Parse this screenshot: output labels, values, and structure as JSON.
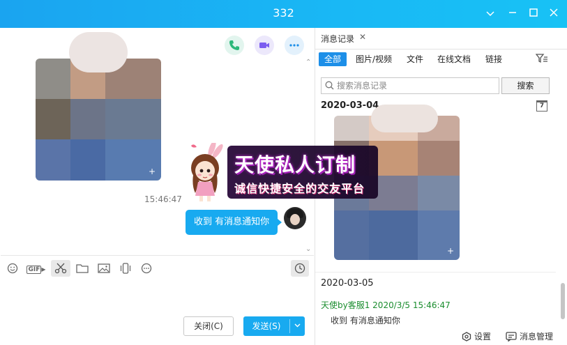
{
  "window": {
    "title": "332"
  },
  "chat": {
    "timestamp": "15:46:47",
    "bubble_text": "收到 有消息通知你"
  },
  "actions": {
    "close_label": "关闭(C)",
    "send_label": "发送(S)"
  },
  "history": {
    "tab_label": "消息记录",
    "filters": [
      "全部",
      "图片/视频",
      "文件",
      "在线文档",
      "链接"
    ],
    "search_placeholder": "搜索消息记录",
    "search_button": "搜索",
    "date1": "2020-03-04",
    "calendar_day": "7",
    "date2": "2020-03-05",
    "sender_line": "天使by客服1 2020/3/5 15:46:47",
    "message": "收到 有消息通知你",
    "footer": {
      "settings": "设置",
      "manage": "消息管理"
    }
  },
  "promo": {
    "line1": "天使私人订制",
    "line2": "诚信快捷安全的交友平台"
  },
  "colors": {
    "accent": "#18aaf0",
    "sender": "#1a8d2e"
  }
}
